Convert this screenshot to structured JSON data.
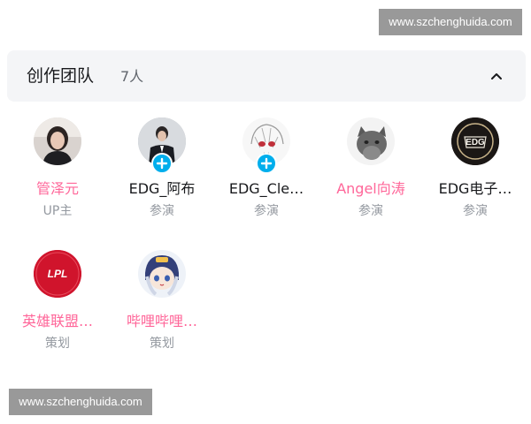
{
  "watermarks": {
    "top": "www.szchenghuida.com",
    "bottom": "www.szchenghuida.com"
  },
  "panel": {
    "title": "创作团队",
    "count": "7人",
    "collapse_icon": "chevron-up-icon"
  },
  "members": [
    {
      "name": "管泽元",
      "role": "UP主",
      "vip": true,
      "follow": false,
      "avatar": "person-photo-avatar"
    },
    {
      "name": "EDG_阿布",
      "role": "参演",
      "vip": false,
      "follow": true,
      "avatar": "person-suit-avatar"
    },
    {
      "name": "EDG_Cle…",
      "role": "参演",
      "vip": false,
      "follow": true,
      "avatar": "anime-sketch-avatar"
    },
    {
      "name": "Angel向涛",
      "role": "参演",
      "vip": true,
      "follow": false,
      "avatar": "cat-avatar"
    },
    {
      "name": "EDG电子…",
      "role": "参演",
      "vip": false,
      "follow": false,
      "avatar": "edg-logo-avatar"
    },
    {
      "name": "英雄联盟…",
      "role": "策划",
      "vip": true,
      "follow": false,
      "avatar": "lpl-logo-avatar"
    },
    {
      "name": "哔哩哔哩…",
      "role": "策划",
      "vip": true,
      "follow": false,
      "avatar": "anime-girl-avatar"
    }
  ],
  "colors": {
    "vip_name": "#ff6699",
    "follow_badge": "#00aeec",
    "header_bg": "#f4f5f7"
  }
}
